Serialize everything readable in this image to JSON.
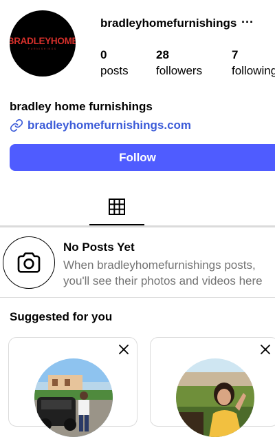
{
  "profile": {
    "username": "bradleyhomefurnishings",
    "more_label": "···",
    "logo_text": "BRADLEYHOME",
    "logo_subtext": "FURNISHINGS",
    "full_name": "bradley home furnishings",
    "website": "bradleyhomefurnishings.com"
  },
  "stats": {
    "posts": {
      "value": "0",
      "label": "posts"
    },
    "followers": {
      "value": "28",
      "label": "followers"
    },
    "following": {
      "value": "7",
      "label": "following"
    }
  },
  "actions": {
    "follow_label": "Follow"
  },
  "tabs": [
    {
      "icon": "grid-icon",
      "active": true
    }
  ],
  "empty_state": {
    "title": "No Posts Yet",
    "subtitle": "When bradleyhomefurnishings posts, you'll see their photos and videos here",
    "icon": "camera-icon"
  },
  "suggestions": {
    "title": "Suggested for you",
    "cards": [
      {
        "close_icon": "close-icon"
      },
      {
        "close_icon": "close-icon"
      }
    ]
  },
  "colors": {
    "accent": "#4f5cff",
    "link": "#3b5bd8",
    "logo_red": "#d8302b",
    "secondary_text": "#737373",
    "divider": "#dbdbdb"
  }
}
